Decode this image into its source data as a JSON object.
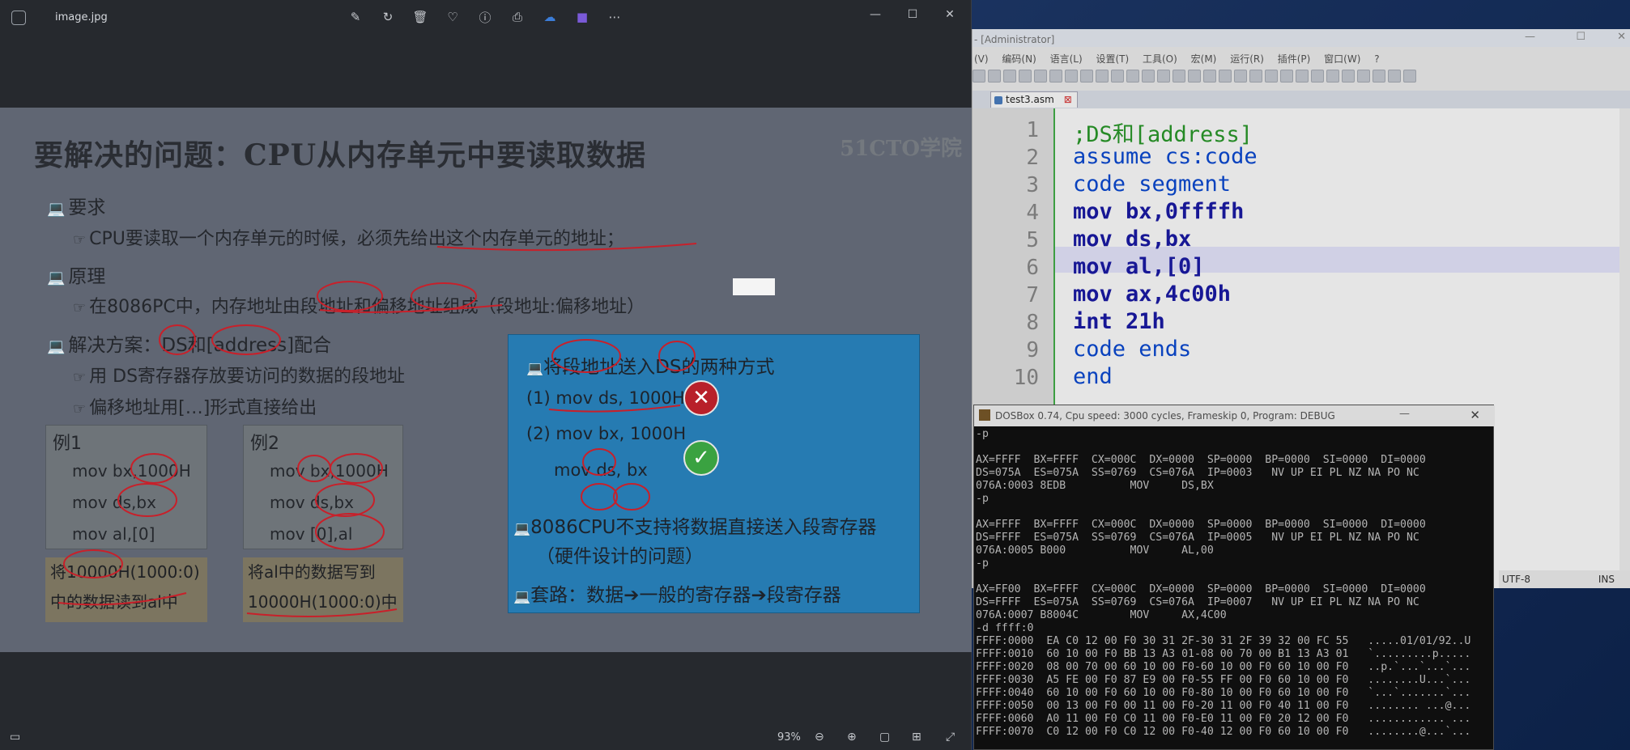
{
  "viewer": {
    "filename": "image.jpg",
    "zoom": "93%",
    "tool_icons": [
      "edit-icon",
      "rotate-icon",
      "delete-icon",
      "favorite-icon",
      "info-icon",
      "print-icon",
      "cloud-icon",
      "video-icon",
      "more-icon"
    ]
  },
  "slide": {
    "title": "要解决的问题：CPU从内存单元中要读取数据",
    "logo": "51CTO学院",
    "req_head": "要求",
    "req_text": "CPU要读取一个内存单元的时候，必须先给出这个内存单元的地址；",
    "prin_head": "原理",
    "prin_text": "在8086PC中，内存地址由段地址和偏移地址组成（段地址:偏移地址）",
    "sol_head": "解决方案：DS和[address]配合",
    "sol_1": "用 DS寄存器存放要访问的数据的段地址",
    "sol_2": "偏移地址用[…]形式直接给出",
    "ex1": {
      "head": "例1",
      "l1": "mov bx,1000H",
      "l2": "mov ds,bx",
      "l3": "mov al,[0]",
      "note1": "将10000H(1000:0)",
      "note2": "中的数据读到al中"
    },
    "ex2": {
      "head": "例2",
      "l1": "mov bx,1000H",
      "l2": "mov ds,bx",
      "l3": "mov [0],al",
      "note1": "将al中的数据写到",
      "note2": "10000H(1000:0)中"
    },
    "box": {
      "head": "将段地址送入DS的两种方式",
      "m1": "(1) mov ds, 1000H",
      "m2": "(2) mov bx, 1000H",
      "m2b": "mov ds, bx",
      "p1": "8086CPU不支持将数据直接送入段寄存器",
      "p1b": "（硬件设计的问题）",
      "p2": "套路：数据➔一般的寄存器➔段寄存器"
    }
  },
  "npp": {
    "title": "- [Administrator]",
    "menu": [
      "(V)",
      "编码(N)",
      "语言(L)",
      "设置(T)",
      "工具(O)",
      "宏(M)",
      "运行(R)",
      "插件(P)",
      "窗口(W)",
      "?"
    ],
    "tab": "test3.asm",
    "lines": [
      "1",
      "2",
      "3",
      "4",
      "5",
      "6",
      "7",
      "8",
      "9",
      "10"
    ],
    "code": [
      ";DS和[address]",
      "assume cs:code",
      "code segment",
      "mov bx,0ffffh",
      "mov ds,bx",
      "mov al,[0]",
      "mov ax,4c00h",
      "int 21h",
      "code ends",
      "end"
    ],
    "encoding": "UTF-8",
    "mode": "INS"
  },
  "dosbox": {
    "title": "DOSBox 0.74, Cpu speed:    3000 cycles, Frameskip  0, Program:    DEBUG",
    "terminal": "-p\n\nAX=FFFF  BX=FFFF  CX=000C  DX=0000  SP=0000  BP=0000  SI=0000  DI=0000\nDS=075A  ES=075A  SS=0769  CS=076A  IP=0003   NV UP EI PL NZ NA PO NC\n076A:0003 8EDB          MOV     DS,BX\n-p\n\nAX=FFFF  BX=FFFF  CX=000C  DX=0000  SP=0000  BP=0000  SI=0000  DI=0000\nDS=FFFF  ES=075A  SS=0769  CS=076A  IP=0005   NV UP EI PL NZ NA PO NC\n076A:0005 B000          MOV     AL,00\n-p\n\nAX=FF00  BX=FFFF  CX=000C  DX=0000  SP=0000  BP=0000  SI=0000  DI=0000\nDS=FFFF  ES=075A  SS=0769  CS=076A  IP=0007   NV UP EI PL NZ NA PO NC\n076A:0007 B8004C        MOV     AX,4C00\n-d ffff:0\nFFFF:0000  EA C0 12 00 F0 30 31 2F-30 31 2F 39 32 00 FC 55   .....01/01/92..U\nFFFF:0010  60 10 00 F0 BB 13 A3 01-08 00 70 00 B1 13 A3 01   `.........p.....\nFFFF:0020  08 00 70 00 60 10 00 F0-60 10 00 F0 60 10 00 F0   ..p.`...`...`...\nFFFF:0030  A5 FE 00 F0 87 E9 00 F0-55 FF 00 F0 60 10 00 F0   ........U...`...\nFFFF:0040  60 10 00 F0 60 10 00 F0-80 10 00 F0 60 10 00 F0   `...`.......`...\nFFFF:0050  00 13 00 F0 00 11 00 F0-20 11 00 F0 40 11 00 F0   ........ ...@...\nFFFF:0060  A0 11 00 F0 C0 11 00 F0-E0 11 00 F0 20 12 00 F0   ............ ...\nFFFF:0070  C0 12 00 F0 C0 12 00 F0-40 12 00 F0 60 10 00 F0   ........@...`..."
  }
}
